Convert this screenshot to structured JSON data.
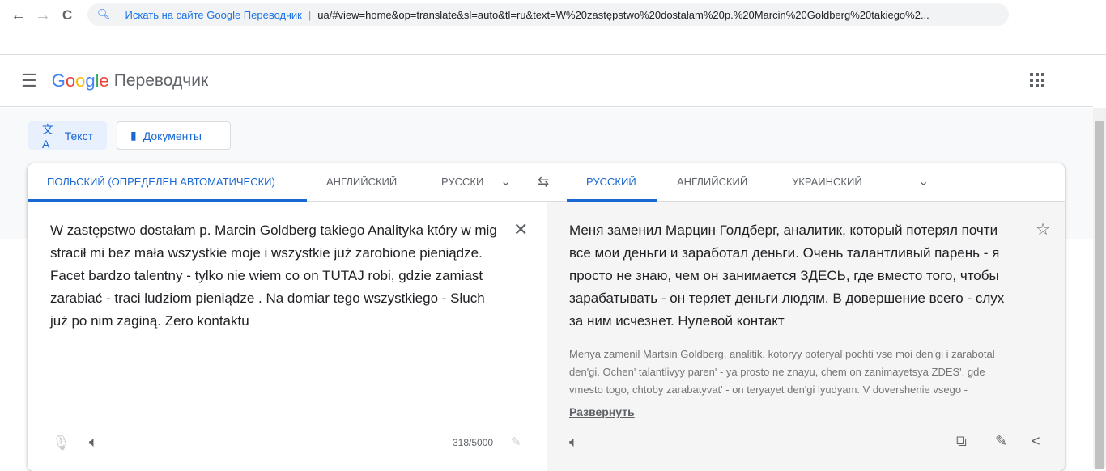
{
  "browser": {
    "back": "←",
    "forward": "→",
    "reload": "C",
    "search_suggestion": "Искать на сайте Google Переводчик",
    "url": "ua/#view=home&op=translate&sl=auto&tl=ru&text=W%20zastępstwo%20dostałam%20p.%20Marcin%20Goldberg%20takiego%2..."
  },
  "header": {
    "logo": "Google",
    "product": "Переводчик"
  },
  "modes": {
    "text": "Текст",
    "documents": "Документы"
  },
  "source_tabs": [
    "ПОЛЬСКИЙ (ОПРЕДЕЛЕН АВТОМАТИЧЕСКИ)",
    "АНГЛИЙСКИЙ",
    "РУССКИ"
  ],
  "target_tabs": [
    "РУССКИЙ",
    "АНГЛИЙСКИЙ",
    "УКРАИНСКИЙ"
  ],
  "source_text": "W zastępstwo dostałam p. Marcin Goldberg takiego Analityka który w mig stracił mi bez mała wszystkie moje i wszystkie już zarobione pieniądze. Facet bardzo talentny - tylko nie wiem co on TUTAJ robi, gdzie zamiast zarabiać - traci ludziom pieniądze . Na domiar tego wszystkiego - Słuch już po nim zaginą. Zero kontaktu",
  "char_count": "318/5000",
  "translation": "Меня заменил Марцин Голдберг, аналитик, который потерял почти все мои деньги и заработал деньги. Очень талантливый парень - я просто не знаю, чем он занимается ЗДЕСЬ, где вместо того, чтобы зарабатывать - он теряет деньги людям. В довершение всего - слух за ним исчезнет. Нулевой контакт",
  "transliteration": "Menya zamenil Martsin Goldberg, analitik, kotoryy poteryal pochti vse moi den'gi i zarabotal den'gi. Ochen' talantlivyy paren' - ya prosto ne znayu, chem on zanimayetsya ZDES', gde vmesto togo, chtoby zarabatyvat' - on teryayet den'gi lyudyam. V dovershenie vsego -",
  "expand": "Развернуть"
}
